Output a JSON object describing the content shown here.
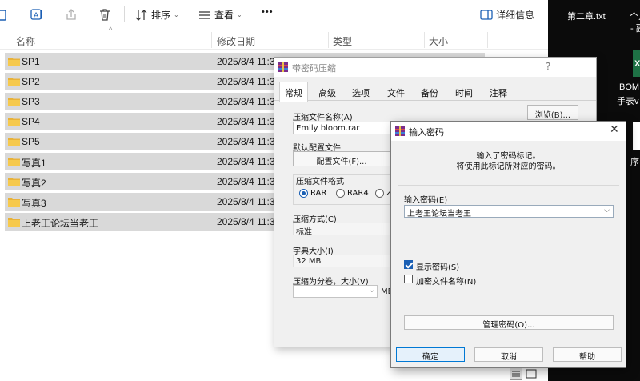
{
  "explorer": {
    "toolbar": {
      "sort_label": "排序",
      "view_label": "查看",
      "more_label": "•••",
      "details_label": "详细信息"
    },
    "columns": {
      "name": "名称",
      "date": "修改日期",
      "type": "类型",
      "size": "大小"
    },
    "rows": [
      {
        "name": "SP1",
        "date": "2025/8/4 11:3"
      },
      {
        "name": "SP2",
        "date": "2025/8/4 11:3"
      },
      {
        "name": "SP3",
        "date": "2025/8/4 11:3"
      },
      {
        "name": "SP4",
        "date": "2025/8/4 11:3"
      },
      {
        "name": "SP5",
        "date": "2025/8/4 11:3"
      },
      {
        "name": "写真1",
        "date": "2025/8/4 11:3"
      },
      {
        "name": "写真2",
        "date": "2025/8/4 11:3"
      },
      {
        "name": "写真3",
        "date": "2025/8/4 11:3"
      },
      {
        "name": "上老王论坛当老王",
        "date": "2025/8/4 11:3"
      }
    ]
  },
  "desktop": {
    "item1_line1": "第二章.txt",
    "partial_t": "t",
    "item2_line1": "个人简",
    "item2_line2": "- 副",
    "item3_line1": "BOM",
    "item3_line2": "手表v",
    "item4": "序"
  },
  "zip_dialog": {
    "title": "带密码压缩",
    "help": "?",
    "tabs": [
      "常规",
      "高级",
      "选项",
      "文件",
      "备份",
      "时间",
      "注释"
    ],
    "archive_name_label": "压缩文件名称(A)",
    "archive_name_value": "Emily bloom.rar",
    "browse_label": "浏览(B)...",
    "profile_label": "默认配置文件",
    "profile_button": "配置文件(F)...",
    "format_label": "压缩文件格式",
    "format_rar": "RAR",
    "format_rar4": "RAR4",
    "format_z": "Z",
    "method_label": "压缩方式(C)",
    "method_value": "标准",
    "dict_label": "字典大小(I)",
    "dict_value": "32 MB",
    "split_label": "压缩为分卷，大小(V)",
    "split_unit": "MB"
  },
  "password_dialog": {
    "title": "输入密码",
    "close": "✕",
    "info_line1": "输入了密码标记。",
    "info_line2": "将使用此标记所对应的密码。",
    "enter_label": "输入密码(E)",
    "password_value": "上老王论坛当老王",
    "show_password": "显示密码(S)",
    "show_password_checked": true,
    "encrypt_names": "加密文件名称(N)",
    "encrypt_names_checked": false,
    "manage_button": "管理密码(O)...",
    "ok": "确定",
    "cancel": "取消",
    "help": "帮助"
  }
}
